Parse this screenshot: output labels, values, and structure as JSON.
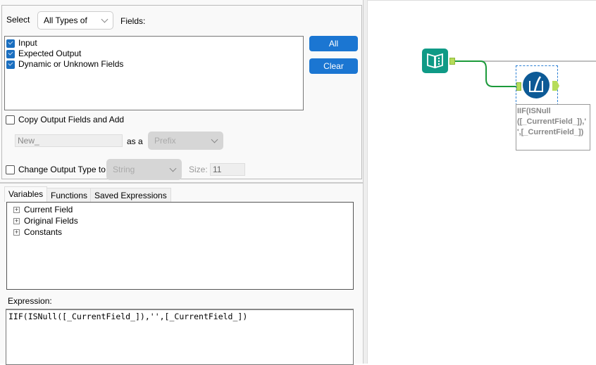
{
  "config": {
    "select_label": "Select",
    "select_value": "All Types of",
    "fields_label": "Fields:",
    "field_list": [
      {
        "label": "Input",
        "checked": true
      },
      {
        "label": "Expected Output",
        "checked": true
      },
      {
        "label": "Dynamic or Unknown Fields",
        "checked": true
      }
    ],
    "all_button": "All",
    "clear_button": "Clear",
    "copy_output_label": "Copy Output Fields and Add",
    "copy_output_checked": false,
    "prefix_value": "New_",
    "as_a_label": "as a",
    "position_value": "Prefix",
    "change_type_label": "Change Output Type to",
    "change_type_checked": false,
    "type_value": "String",
    "size_label": "Size:",
    "size_value": "11"
  },
  "expr": {
    "tabs": [
      {
        "label": "Variables",
        "active": true
      },
      {
        "label": "Functions"
      },
      {
        "label": "Saved Expressions"
      }
    ],
    "tree": [
      "Current Field",
      "Original Fields",
      "Constants"
    ],
    "expression_label": "Expression:",
    "expression_value": "IIF(ISNull([_CurrentField_]),'',[_CurrentField_])"
  },
  "canvas": {
    "annotation": [
      "IIF(ISNull",
      "([_CurrentField_]),'",
      "',[_CurrentField_])"
    ],
    "colors": {
      "input_tool": "#0f9a86",
      "formula_tool": "#0d5a96",
      "connector": "#1b9a3a",
      "anchor": "#b6dc5a"
    }
  }
}
